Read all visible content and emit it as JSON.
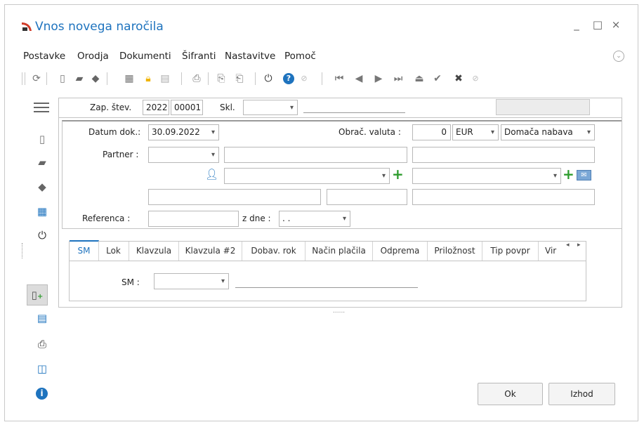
{
  "window": {
    "title": "Vnos novega naročila",
    "minimize": "_",
    "maximize": "□",
    "close": "×"
  },
  "menu": [
    "Postavke",
    "Orodja",
    "Dokumenti",
    "Šifranti",
    "Nastavitve",
    "Pomoč"
  ],
  "header": {
    "zap_label": "Zap. štev.",
    "zap_year": "2022",
    "zap_num": "00001",
    "skl_label": "Skl.",
    "skl_value": ""
  },
  "form": {
    "datum_label": "Datum dok.:",
    "datum_value": "30.09.2022",
    "valuta_label": "Obrač. valuta :",
    "valuta_amount": "0",
    "valuta_currency": "EUR",
    "nabava_value": "Domača nabava",
    "partner_label": "Partner :",
    "partner_value": "",
    "referenca_label": "Referenca :",
    "referenca_value": "",
    "zdne_label": "z dne :",
    "zdne_value": ". ."
  },
  "tabs": [
    "SM",
    "Lok",
    "Klavzula",
    "Klavzula #2",
    "Dobav. rok",
    "Način plačila",
    "Odprema",
    "Priložnost",
    "Tip povpr",
    "Vir"
  ],
  "tab_content": {
    "sm_label": "SM :",
    "sm_value": ""
  },
  "splitter": "......",
  "buttons": {
    "ok": "Ok",
    "exit": "Izhod"
  },
  "colors": {
    "accent": "#1e73be",
    "green": "#2e9c2e",
    "gold": "#f0b400"
  },
  "icons": {
    "refresh": "refresh-icon",
    "new": "new-document-icon",
    "folder": "folder-icon",
    "eraser": "eraser-icon",
    "calc": "calculator-icon",
    "lock": "lock-icon",
    "print": "print-icon",
    "power": "power-icon",
    "help": "help-icon"
  }
}
